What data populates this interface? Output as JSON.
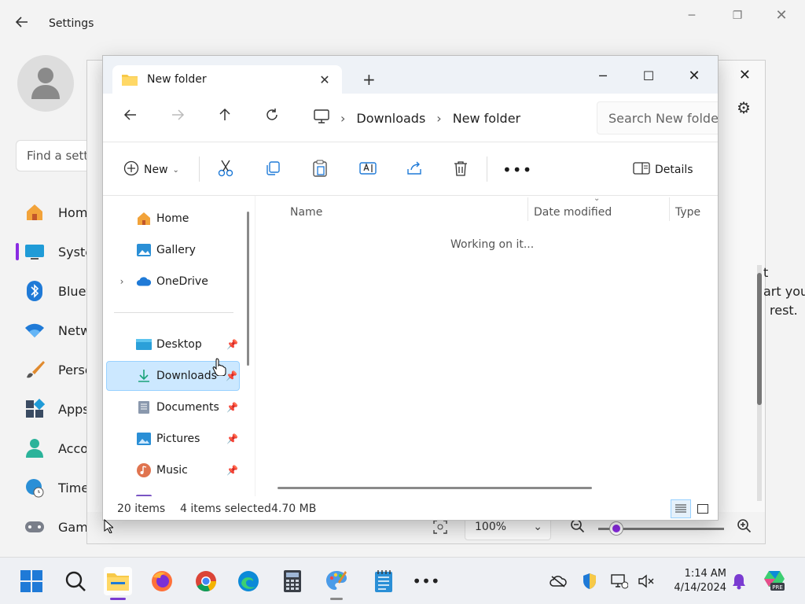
{
  "settings": {
    "title": "Settings",
    "find_placeholder": "Find a setting",
    "nav": [
      {
        "label": "Home"
      },
      {
        "label": "System"
      },
      {
        "label": "Bluetooth & devices"
      },
      {
        "label": "Network & internet"
      },
      {
        "label": "Personalization"
      },
      {
        "label": "Apps"
      },
      {
        "label": "Accounts"
      },
      {
        "label": "Time & language"
      },
      {
        "label": "Gaming"
      }
    ],
    "right_text": [
      "t",
      "art you",
      "rest."
    ]
  },
  "paint": {
    "zoom": "100%"
  },
  "explorer": {
    "tab_title": "New folder",
    "breadcrumbs": [
      "Downloads",
      "New folder"
    ],
    "search_placeholder": "Search New folder",
    "toolbar": {
      "new_label": "New",
      "details_label": "Details"
    },
    "nav_pane": {
      "items": [
        {
          "label": "Home"
        },
        {
          "label": "Gallery"
        },
        {
          "label": "OneDrive"
        },
        {
          "label": "Desktop"
        },
        {
          "label": "Downloads"
        },
        {
          "label": "Documents"
        },
        {
          "label": "Pictures"
        },
        {
          "label": "Music"
        }
      ]
    },
    "columns": [
      "Name",
      "Date modified",
      "Type"
    ],
    "loading_text": "Working on it...",
    "status": {
      "items": "20 items",
      "selected": "4 items selected",
      "size": "4.70 MB"
    }
  },
  "taskbar": {
    "time": "1:14 AM",
    "date": "4/14/2024"
  },
  "colors": {
    "accent": "#7a3bd1",
    "selection": "#cce8ff",
    "selection_border": "#99d1ff"
  }
}
